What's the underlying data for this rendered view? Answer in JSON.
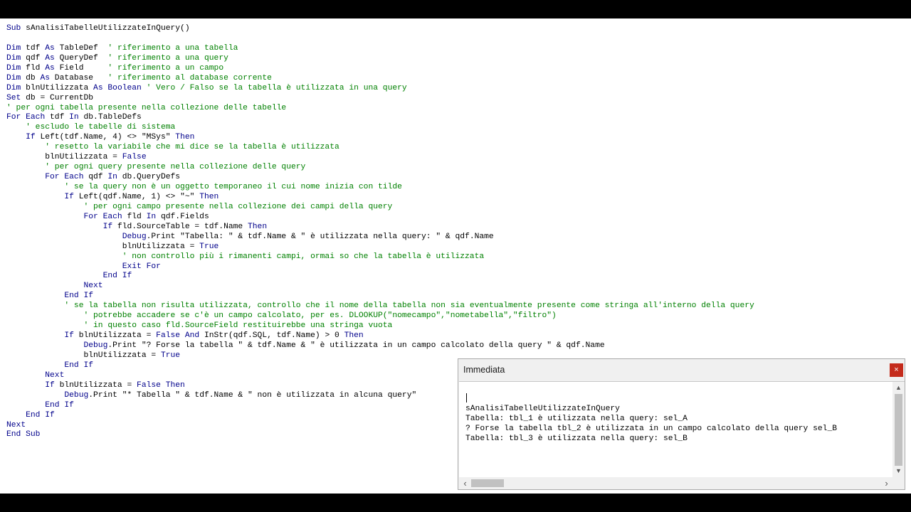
{
  "code": [
    {
      "indent": "",
      "parts": [
        {
          "k": "kw",
          "t": "Sub"
        },
        {
          "t": " sAnalisiTabelleUtilizzateInQuery()"
        }
      ]
    },
    {
      "indent": "",
      "parts": []
    },
    {
      "indent": "",
      "parts": [
        {
          "k": "kw",
          "t": "Dim"
        },
        {
          "t": " tdf "
        },
        {
          "k": "kw",
          "t": "As"
        },
        {
          "t": " TableDef  "
        },
        {
          "k": "cm",
          "t": "' riferimento a una tabella"
        }
      ]
    },
    {
      "indent": "",
      "parts": [
        {
          "k": "kw",
          "t": "Dim"
        },
        {
          "t": " qdf "
        },
        {
          "k": "kw",
          "t": "As"
        },
        {
          "t": " QueryDef  "
        },
        {
          "k": "cm",
          "t": "' riferimento a una query"
        }
      ]
    },
    {
      "indent": "",
      "parts": [
        {
          "k": "kw",
          "t": "Dim"
        },
        {
          "t": " fld "
        },
        {
          "k": "kw",
          "t": "As"
        },
        {
          "t": " Field     "
        },
        {
          "k": "cm",
          "t": "' riferimento a un campo"
        }
      ]
    },
    {
      "indent": "",
      "parts": [
        {
          "k": "kw",
          "t": "Dim"
        },
        {
          "t": " db "
        },
        {
          "k": "kw",
          "t": "As"
        },
        {
          "t": " Database   "
        },
        {
          "k": "cm",
          "t": "' riferimento al database corrente"
        }
      ]
    },
    {
      "indent": "",
      "parts": [
        {
          "k": "kw",
          "t": "Dim"
        },
        {
          "t": " blnUtilizzata "
        },
        {
          "k": "kw",
          "t": "As Boolean"
        },
        {
          "t": " "
        },
        {
          "k": "cm",
          "t": "' Vero / Falso se la tabella è utilizzata in una query"
        }
      ]
    },
    {
      "indent": "",
      "parts": [
        {
          "k": "kw",
          "t": "Set"
        },
        {
          "t": " db = CurrentDb"
        }
      ]
    },
    {
      "indent": "",
      "parts": [
        {
          "k": "cm",
          "t": "' per ogni tabella presente nella collezione delle tabelle"
        }
      ]
    },
    {
      "indent": "",
      "parts": [
        {
          "k": "kw",
          "t": "For Each"
        },
        {
          "t": " tdf "
        },
        {
          "k": "kw",
          "t": "In"
        },
        {
          "t": " db.TableDefs"
        }
      ]
    },
    {
      "indent": "    ",
      "parts": [
        {
          "k": "cm",
          "t": "' escludo le tabelle di sistema"
        }
      ]
    },
    {
      "indent": "    ",
      "parts": [
        {
          "k": "kw",
          "t": "If"
        },
        {
          "t": " Left(tdf.Name, 4) <> \"MSys\" "
        },
        {
          "k": "kw",
          "t": "Then"
        }
      ]
    },
    {
      "indent": "        ",
      "parts": [
        {
          "k": "cm",
          "t": "' resetto la variabile che mi dice se la tabella è utilizzata"
        }
      ]
    },
    {
      "indent": "        ",
      "parts": [
        {
          "t": "blnUtilizzata = "
        },
        {
          "k": "kw",
          "t": "False"
        }
      ]
    },
    {
      "indent": "        ",
      "parts": [
        {
          "k": "cm",
          "t": "' per ogni query presente nella collezione delle query"
        }
      ]
    },
    {
      "indent": "        ",
      "parts": [
        {
          "k": "kw",
          "t": "For Each"
        },
        {
          "t": " qdf "
        },
        {
          "k": "kw",
          "t": "In"
        },
        {
          "t": " db.QueryDefs"
        }
      ]
    },
    {
      "indent": "            ",
      "parts": [
        {
          "k": "cm",
          "t": "' se la query non è un oggetto temporaneo il cui nome inizia con tilde"
        }
      ]
    },
    {
      "indent": "            ",
      "parts": [
        {
          "k": "kw",
          "t": "If"
        },
        {
          "t": " Left(qdf.Name, 1) <> \"~\" "
        },
        {
          "k": "kw",
          "t": "Then"
        }
      ]
    },
    {
      "indent": "                ",
      "parts": [
        {
          "k": "cm",
          "t": "' per ogni campo presente nella collezione dei campi della query"
        }
      ]
    },
    {
      "indent": "                ",
      "parts": [
        {
          "k": "kw",
          "t": "For Each"
        },
        {
          "t": " fld "
        },
        {
          "k": "kw",
          "t": "In"
        },
        {
          "t": " qdf.Fields"
        }
      ]
    },
    {
      "indent": "                    ",
      "parts": [
        {
          "k": "kw",
          "t": "If"
        },
        {
          "t": " fld.SourceTable = tdf.Name "
        },
        {
          "k": "kw",
          "t": "Then"
        }
      ]
    },
    {
      "indent": "                        ",
      "parts": [
        {
          "k": "kw",
          "t": "Debug"
        },
        {
          "t": ".Print \"Tabella: \" & tdf.Name & \" è utilizzata nella query: \" & qdf.Name"
        }
      ]
    },
    {
      "indent": "                        ",
      "parts": [
        {
          "t": "blnUtilizzata = "
        },
        {
          "k": "kw",
          "t": "True"
        }
      ]
    },
    {
      "indent": "                        ",
      "parts": [
        {
          "k": "cm",
          "t": "' non controllo più i rimanenti campi, ormai so che la tabella è utilizzata"
        }
      ]
    },
    {
      "indent": "                        ",
      "parts": [
        {
          "k": "kw",
          "t": "Exit For"
        }
      ]
    },
    {
      "indent": "                    ",
      "parts": [
        {
          "k": "kw",
          "t": "End If"
        }
      ]
    },
    {
      "indent": "                ",
      "parts": [
        {
          "k": "kw",
          "t": "Next"
        }
      ]
    },
    {
      "indent": "            ",
      "parts": [
        {
          "k": "kw",
          "t": "End If"
        }
      ]
    },
    {
      "indent": "            ",
      "parts": [
        {
          "k": "cm",
          "t": "' se la tabella non risulta utilizzata, controllo che il nome della tabella non sia eventualmente presente come stringa all'interno della query"
        }
      ]
    },
    {
      "indent": "                ",
      "parts": [
        {
          "k": "cm",
          "t": "' potrebbe accadere se c'è un campo calcolato, per es. DLOOKUP(\"nomecampo\",\"nometabella\",\"filtro\")"
        }
      ]
    },
    {
      "indent": "                ",
      "parts": [
        {
          "k": "cm",
          "t": "' in questo caso fld.SourceField restituirebbe una stringa vuota"
        }
      ]
    },
    {
      "indent": "            ",
      "parts": [
        {
          "k": "kw",
          "t": "If"
        },
        {
          "t": " blnUtilizzata = "
        },
        {
          "k": "kw",
          "t": "False And"
        },
        {
          "t": " InStr(qdf.SQL, tdf.Name) > 0 "
        },
        {
          "k": "kw",
          "t": "Then"
        }
      ]
    },
    {
      "indent": "                ",
      "parts": [
        {
          "k": "kw",
          "t": "Debug"
        },
        {
          "t": ".Print \"? Forse la tabella \" & tdf.Name & \" è utilizzata in un campo calcolato della query \" & qdf.Name"
        }
      ]
    },
    {
      "indent": "                ",
      "parts": [
        {
          "t": "blnUtilizzata = "
        },
        {
          "k": "kw",
          "t": "True"
        }
      ]
    },
    {
      "indent": "            ",
      "parts": [
        {
          "k": "kw",
          "t": "End If"
        }
      ]
    },
    {
      "indent": "        ",
      "parts": [
        {
          "k": "kw",
          "t": "Next"
        }
      ]
    },
    {
      "indent": "        ",
      "parts": [
        {
          "k": "kw",
          "t": "If"
        },
        {
          "t": " blnUtilizzata = "
        },
        {
          "k": "kw",
          "t": "False Then"
        }
      ]
    },
    {
      "indent": "            ",
      "parts": [
        {
          "k": "kw",
          "t": "Debug"
        },
        {
          "t": ".Print \"* Tabella \" & tdf.Name & \" non è utilizzata in alcuna query\""
        }
      ]
    },
    {
      "indent": "        ",
      "parts": [
        {
          "k": "kw",
          "t": "End If"
        }
      ]
    },
    {
      "indent": "    ",
      "parts": [
        {
          "k": "kw",
          "t": "End If"
        }
      ]
    },
    {
      "indent": "",
      "parts": [
        {
          "k": "kw",
          "t": "Next"
        }
      ]
    },
    {
      "indent": "",
      "parts": [
        {
          "k": "kw",
          "t": "End Sub"
        }
      ]
    }
  ],
  "immediate": {
    "title": "Immediata",
    "close_glyph": "×",
    "lines": [
      "sAnalisiTabelleUtilizzateInQuery",
      "Tabella: tbl_1 è utilizzata nella query: sel_A",
      "? Forse la tabella tbl_2 è utilizzata in un campo calcolato della query sel_B",
      "Tabella: tbl_3 è utilizzata nella query: sel_B"
    ],
    "arrows": {
      "up": "▲",
      "down": "▼",
      "left": "‹",
      "right": "›"
    }
  },
  "colors": {
    "keyword": "#00008b",
    "comment": "#008000",
    "close": "#c42b1c"
  }
}
